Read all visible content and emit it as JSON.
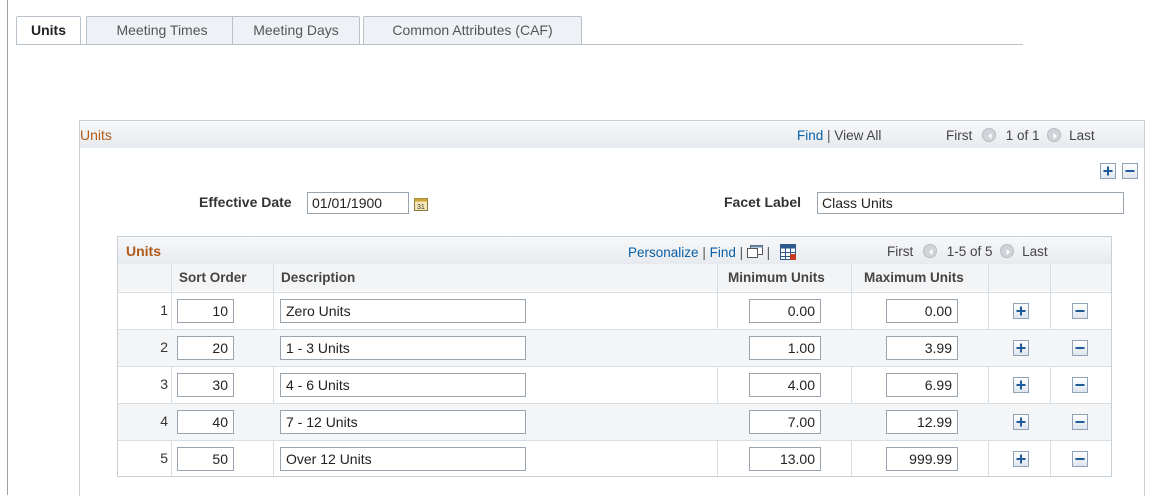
{
  "tabs": [
    {
      "label": "Units",
      "active": true
    },
    {
      "label": "Meeting Times",
      "active": false
    },
    {
      "label": "Meeting Days",
      "active": false
    },
    {
      "label": "Common Attributes (CAF)",
      "active": false
    }
  ],
  "outer": {
    "title": "Units",
    "find": "Find",
    "sep": "|",
    "view_all": "View All",
    "first": "First",
    "count": "1 of 1",
    "last": "Last"
  },
  "form": {
    "effective_date_label": "Effective Date",
    "effective_date_value": "01/01/1900",
    "facet_label_label": "Facet Label",
    "facet_label_value": "Class Units"
  },
  "grid": {
    "title": "Units",
    "personalize": "Personalize",
    "sep": "|",
    "find": "Find",
    "first": "First",
    "count": "1-5 of 5",
    "last": "Last",
    "headers": {
      "sort_order": "Sort Order",
      "description": "Description",
      "min_units": "Minimum Units",
      "max_units": "Maximum Units"
    },
    "rows": [
      {
        "num": "1",
        "sort_order": "10",
        "description": "Zero Units",
        "min_units": "0.00",
        "max_units": "0.00"
      },
      {
        "num": "2",
        "sort_order": "20",
        "description": "1 - 3 Units",
        "min_units": "1.00",
        "max_units": "3.99"
      },
      {
        "num": "3",
        "sort_order": "30",
        "description": "4 - 6 Units",
        "min_units": "4.00",
        "max_units": "6.99"
      },
      {
        "num": "4",
        "sort_order": "40",
        "description": "7 - 12 Units",
        "min_units": "7.00",
        "max_units": "12.99"
      },
      {
        "num": "5",
        "sort_order": "50",
        "description": "Over 12 Units",
        "min_units": "13.00",
        "max_units": "999.99"
      }
    ]
  },
  "icons": {
    "prev": "left-arrow-icon",
    "next": "right-arrow-icon",
    "add": "plus-icon",
    "delete": "minus-icon",
    "calendar": "calendar-icon",
    "zoom": "new-window-icon",
    "download": "spreadsheet-icon"
  },
  "colors": {
    "title_orange": "#b15b1a",
    "link_blue": "#0b5fa5",
    "border": "#c7cfd7"
  }
}
